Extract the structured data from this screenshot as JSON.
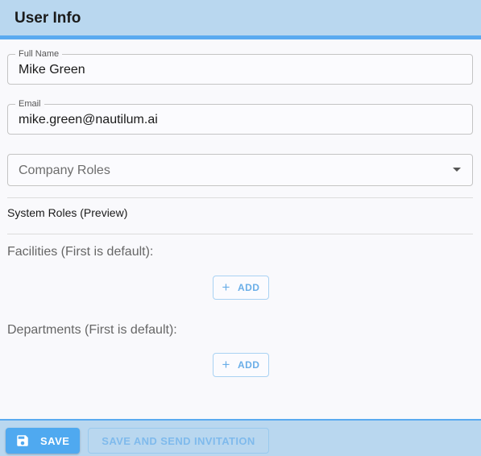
{
  "header": {
    "title": "User Info"
  },
  "form": {
    "full_name": {
      "label": "Full Name",
      "value": "Mike Green"
    },
    "email": {
      "label": "Email",
      "value": "mike.green@nautilum.ai"
    },
    "company_roles": {
      "placeholder": "Company Roles"
    },
    "system_roles_label": "System Roles (Preview)",
    "facilities": {
      "label": "Facilities (First is default):",
      "add_label": "ADD"
    },
    "departments": {
      "label": "Departments (First is default):",
      "add_label": "ADD"
    }
  },
  "footer": {
    "save_label": "SAVE",
    "save_invite_label": "SAVE AND SEND INVITATION"
  },
  "icons": {
    "plus": "plus-icon",
    "save": "floppy-disk-icon",
    "caret": "chevron-down-icon"
  },
  "colors": {
    "accent": "#4fa9f0",
    "header_bg": "#b9d7ef",
    "accent_border": "#5aaaf0"
  }
}
